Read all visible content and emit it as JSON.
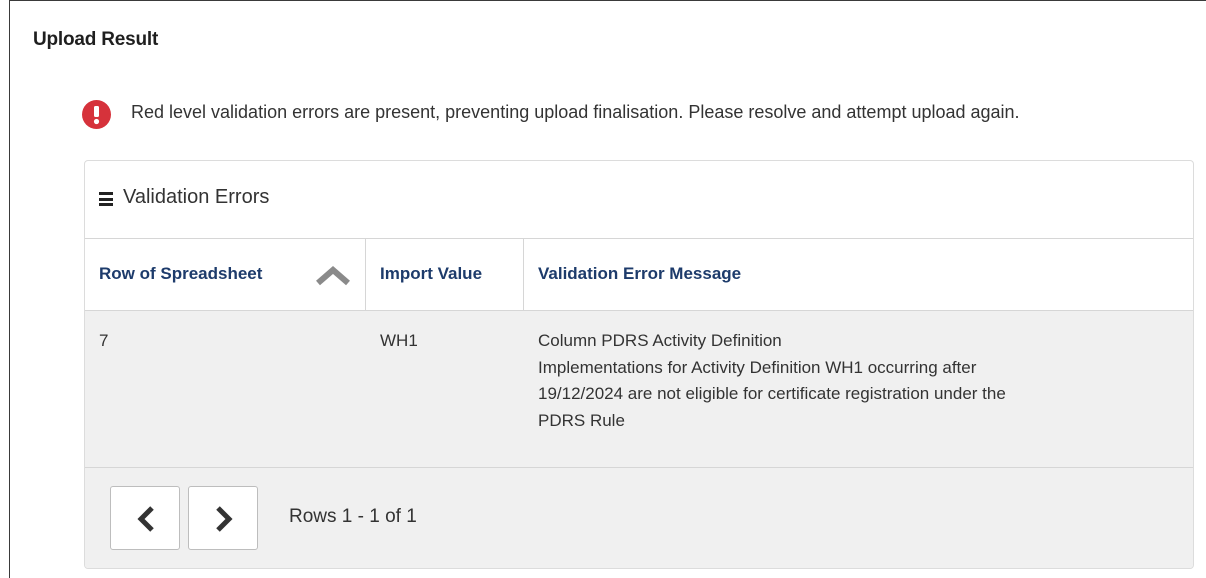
{
  "section": {
    "title": "Upload Result"
  },
  "alert": {
    "icon": "exclamation-circle-icon",
    "color": "#d6323b",
    "message": "Red level validation errors are present, preventing upload finalisation. Please resolve and attempt upload again."
  },
  "panel": {
    "icon": "menu-icon",
    "title": "Validation Errors"
  },
  "table": {
    "columns": [
      "Row of Spreadsheet",
      "Import Value",
      "Validation Error Message"
    ],
    "sort": {
      "column": "Row of Spreadsheet",
      "direction": "ascending",
      "icon": "chevron-up-icon"
    },
    "rows": [
      {
        "row": "7",
        "import_value": "WH1",
        "message_lines": [
          "Column PDRS Activity Definition",
          "Implementations for Activity Definition WH1 occurring after",
          "19/12/2024 are not eligible for certificate registration under the",
          "PDRS Rule"
        ]
      }
    ]
  },
  "pager": {
    "prev_icon": "chevron-left-icon",
    "next_icon": "chevron-right-icon",
    "summary": "Rows 1 - 1 of 1"
  },
  "colors": {
    "header_text": "#1d3b6b",
    "row_background": "#f0f0f0"
  }
}
